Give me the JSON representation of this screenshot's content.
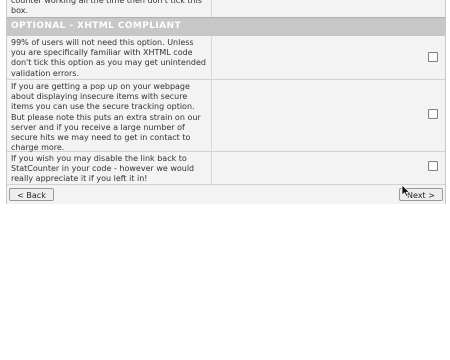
{
  "prev_section_tail": "counter working all the time then don't tick this box.",
  "section": {
    "title": "OPTIONAL - XHTML COMPLIANT"
  },
  "options": [
    {
      "text": "99% of users will not need this option. Unless you are specifically familiar with XHTML code don't tick this option as you may get unintended validation errors.",
      "checked": false
    },
    {
      "text": "If you are getting a pop up on your webpage about displaying insecure items with secure items you can use the secure tracking option. But please note this puts an extra strain on our server and if you receive a large number of secure hits we may need to get in contact to charge more.",
      "checked": false
    },
    {
      "text": "If you wish you may disable the link back to StatCounter in your code - however we would really appreciate it if you left it in!",
      "checked": false
    }
  ],
  "nav": {
    "back_label": "< Back",
    "next_label": "Next >"
  }
}
